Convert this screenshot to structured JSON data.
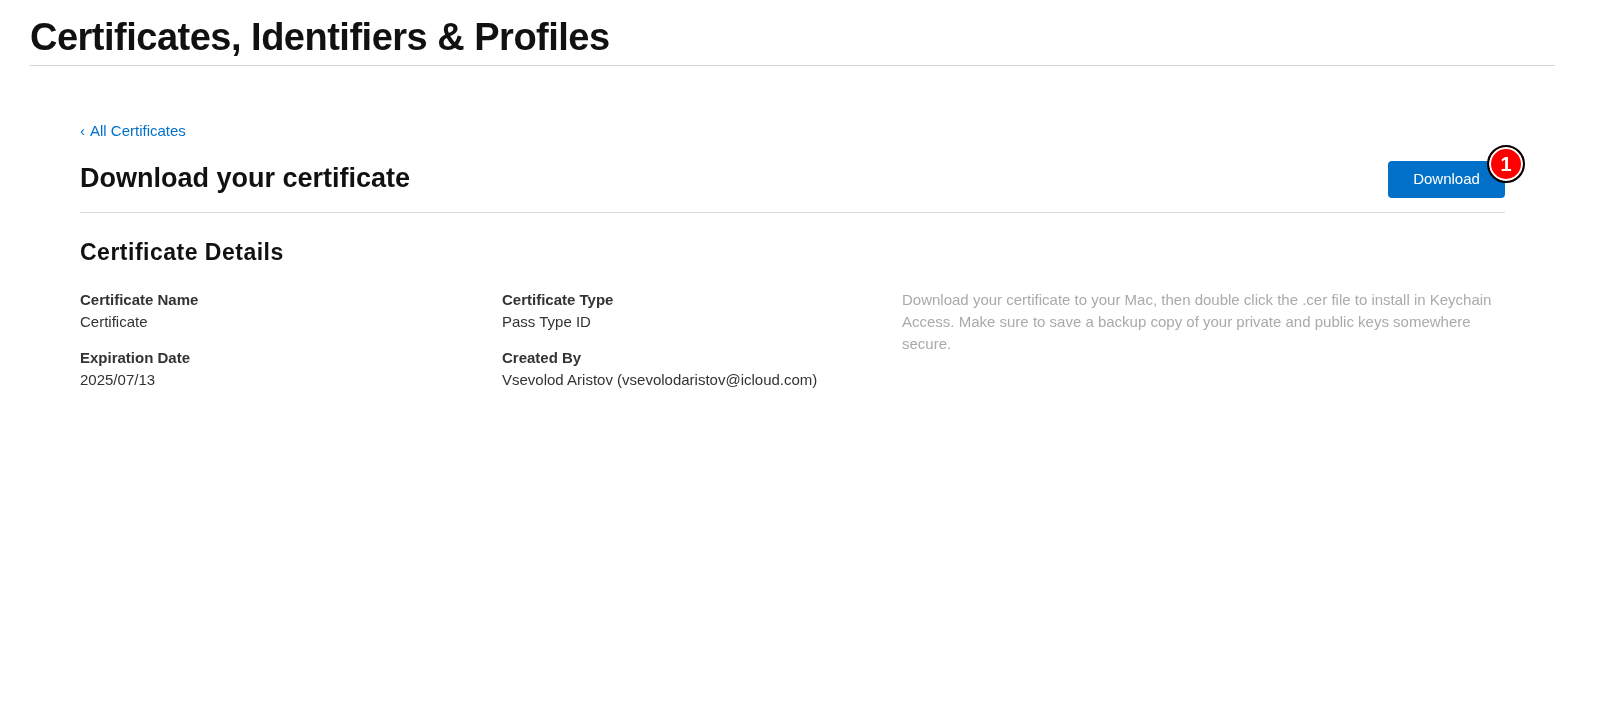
{
  "page_title": "Certificates, Identifiers & Profiles",
  "back_link": {
    "icon": "‹",
    "label": "All Certificates"
  },
  "heading": "Download your certificate",
  "download_button": {
    "label": "Download",
    "badge": "1"
  },
  "section_title": "Certificate Details",
  "fields": [
    {
      "label": "Certificate Name",
      "value": "Certificate"
    },
    {
      "label": "Certificate Type",
      "value": "Pass Type ID"
    },
    {
      "label": "Expiration Date",
      "value": "2025/07/13"
    },
    {
      "label": "Created By",
      "value": "Vsevolod Aristov (vsevolodaristov@icloud.com)"
    }
  ],
  "help_text": "Download your certificate to your Mac, then double click the .cer file to install in Keychain Access. Make sure to save a backup copy of your private and public keys somewhere secure."
}
